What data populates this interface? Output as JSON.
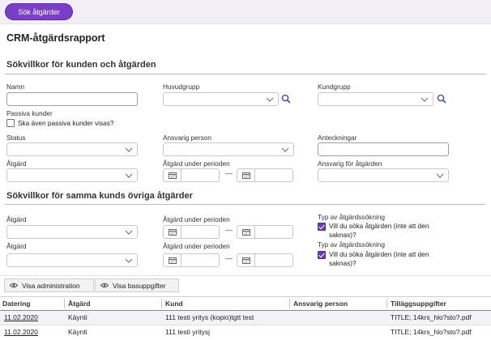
{
  "toolbar": {
    "search_button": "Sök åtgärder"
  },
  "page_title": "CRM-åtgärdsrapport",
  "section1": {
    "title": "Sökvillkor för kunden och åtgärden",
    "name_label": "Namn",
    "main_group_label": "Huvudgrupp",
    "customer_group_label": "Kundgrupp",
    "passive_label": "Passiva kunder",
    "passive_checkbox": "Ska även passiva kunder visas?",
    "status_label": "Status",
    "responsible_label": "Ansvarig person",
    "notes_label": "Anteckningar",
    "action_label": "Åtgärd",
    "action_period_label": "Åtgärd under perioden",
    "action_responsible_label": "Ansvarig för åtgärden"
  },
  "section2": {
    "title": "Sökvillkor för samma kunds övriga åtgärder",
    "rows": [
      {
        "action_label": "Åtgärd",
        "period_label": "Åtgärd under perioden",
        "type_label": "Typ av åtgärdssökning",
        "checkbox_text_1": "Vill du söka åtgärden (inte att den",
        "checkbox_text_2": "saknas)?"
      },
      {
        "action_label": "Åtgärd",
        "period_label": "Åtgärd under perioden",
        "type_label": "Typ av åtgärdssökning",
        "checkbox_text_1": "Vill du söka åtgärden (inte att den",
        "checkbox_text_2": "saknas)?"
      }
    ]
  },
  "buttons": {
    "admin": "Visa administration",
    "basic": "Visa basuppgifter"
  },
  "table": {
    "headers": [
      "Datering",
      "Åtgärd",
      "Kund",
      "Ansvarig person",
      "Tilläggsuppgifter"
    ],
    "rows": [
      [
        "11.02.2020",
        "Käynti",
        "111 testi yritys (kopio)tgtt test",
        "",
        "TITLE; 14krs_hlo?sto?.pdf"
      ],
      [
        "11.02.2020",
        "Käynti",
        "111 testi yritysj",
        "",
        "TITLE; 14krs_hlo?sto?.pdf"
      ]
    ]
  },
  "colors": {
    "accent": "#7a3fc7",
    "row_alt": "#f3f2f7",
    "header_bg": "#ffffff"
  },
  "icons": {
    "search": "magnifier-icon",
    "dropdown": "chevron-down-icon",
    "calendar": "calendar-icon",
    "eye": "eye-icon"
  }
}
